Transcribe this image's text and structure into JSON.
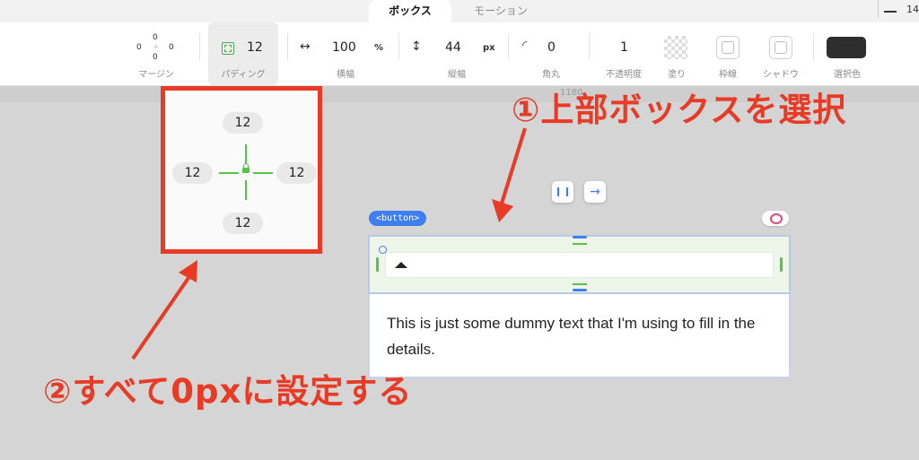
{
  "tabs": [
    {
      "label": "ボックス",
      "active": true
    },
    {
      "label": "モーション",
      "active": false
    }
  ],
  "window": {
    "page_indicator": "14"
  },
  "toolbar": {
    "margin": {
      "label": "マージン",
      "top": "0",
      "left": "0",
      "right": "0",
      "bottom": "0"
    },
    "padding": {
      "label": "パディング",
      "value": "12"
    },
    "width": {
      "label": "横幅",
      "value": "100",
      "unit": "%",
      "symbol": "↔"
    },
    "height": {
      "label": "縦幅",
      "value": "44",
      "unit": "px",
      "symbol": "↕"
    },
    "radius": {
      "label": "角丸",
      "value": "0"
    },
    "opacity": {
      "label": "不透明度",
      "value": "1"
    },
    "fill": {
      "label": "塗り"
    },
    "border": {
      "label": "枠線"
    },
    "shadow": {
      "label": "シャドウ"
    },
    "selected_color": {
      "label": "選択色",
      "color": "#2e2e2e"
    }
  },
  "ruler": {
    "label": "1180"
  },
  "padding_popup": {
    "top": "12",
    "left": "12",
    "right": "12",
    "bottom": "12"
  },
  "canvas": {
    "button_badge": "<button>",
    "body_text": "This is just some dummy text that I'm using to fill in the details."
  },
  "annotations": {
    "step1": "①上部ボックスを選択",
    "step2": "②すべて0pxに設定する"
  },
  "colors": {
    "annotation": "#e83a25",
    "accent": "#3f7ef0",
    "padding_guide": "#57c34a"
  }
}
